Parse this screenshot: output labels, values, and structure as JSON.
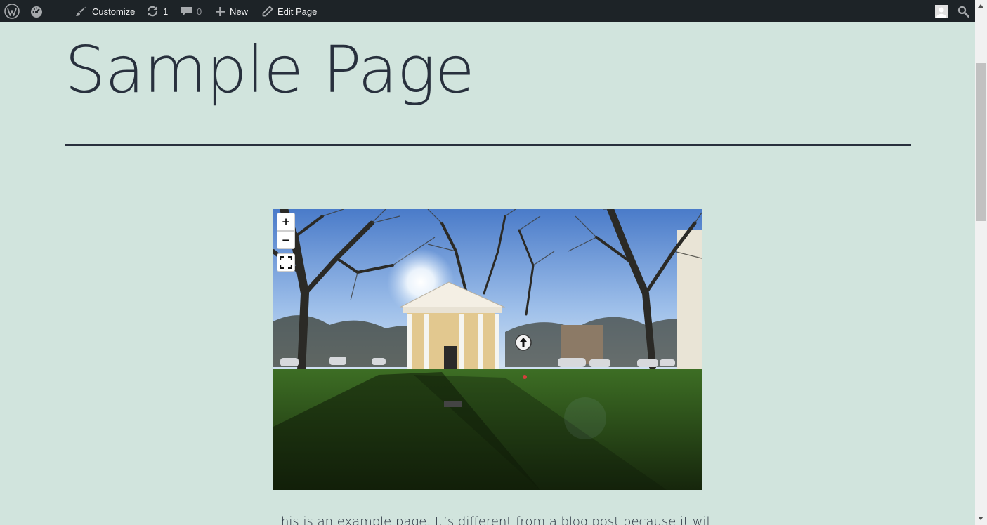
{
  "adminbar": {
    "wp_logo": "wordpress-icon",
    "dashboard_icon": "dashboard-icon",
    "customize_label": "Customize",
    "updates_count": "1",
    "comments_count": "0",
    "new_label": "New",
    "edit_page_label": "Edit Page",
    "avatar_icon": "avatar-icon",
    "search_icon": "search-icon",
    "bg_color": "#1d2327"
  },
  "page": {
    "title": "Sample Page",
    "body_text": "This is an example page. It’s different from a blog post because it will",
    "background": "#d1e4dd",
    "text_color": "#28303d"
  },
  "viewer": {
    "zoom_in_label": "+",
    "zoom_out_label": "−",
    "fullscreen_icon": "fullscreen-icon",
    "nav_icon": "arrow-up-circle-icon"
  }
}
